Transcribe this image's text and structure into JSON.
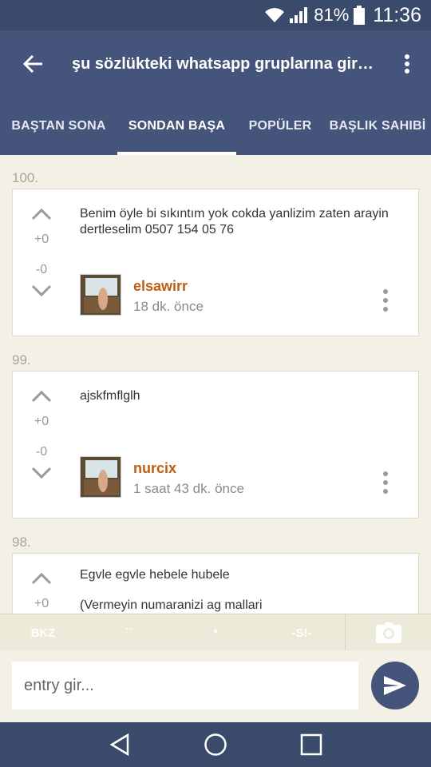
{
  "status_bar": {
    "battery": "81%",
    "time": "11:36"
  },
  "app_bar": {
    "title": "şu sözlükteki whatsapp gruplarına girmek"
  },
  "tabs": [
    {
      "label": "BAŞTAN SONA"
    },
    {
      "label": "SONDAN BAŞA"
    },
    {
      "label": "POPÜLER"
    },
    {
      "label": "BAŞLIK SAHIBİ"
    }
  ],
  "entries": [
    {
      "number": "100.",
      "text": "Benim öyle bi sıkıntım yok cokda yanlizim zaten arayin dertleselim 0507 154 05 76",
      "upvotes": "+0",
      "downvotes": "-0",
      "author": "elsawirr",
      "time": "18 dk. önce"
    },
    {
      "number": "99.",
      "text": "ajskfmflglh",
      "upvotes": "+0",
      "downvotes": "-0",
      "author": "nurcix",
      "time": "1 saat 43 dk. önce"
    },
    {
      "number": "98.",
      "text": "Egvle egvle hebele hubele",
      "text2": "(Vermeyin numaranizi ag mallari",
      "upvotes": "+0"
    }
  ],
  "toolbar": {
    "bkz": "BKZ",
    "backtick": "``",
    "star": "*",
    "spoiler": "-S!-"
  },
  "input": {
    "placeholder": "entry gir..."
  },
  "colors": {
    "primary": "#44547a",
    "status_bar": "#3a4a6b",
    "background": "#f3f1e6",
    "author": "#c15c13"
  }
}
